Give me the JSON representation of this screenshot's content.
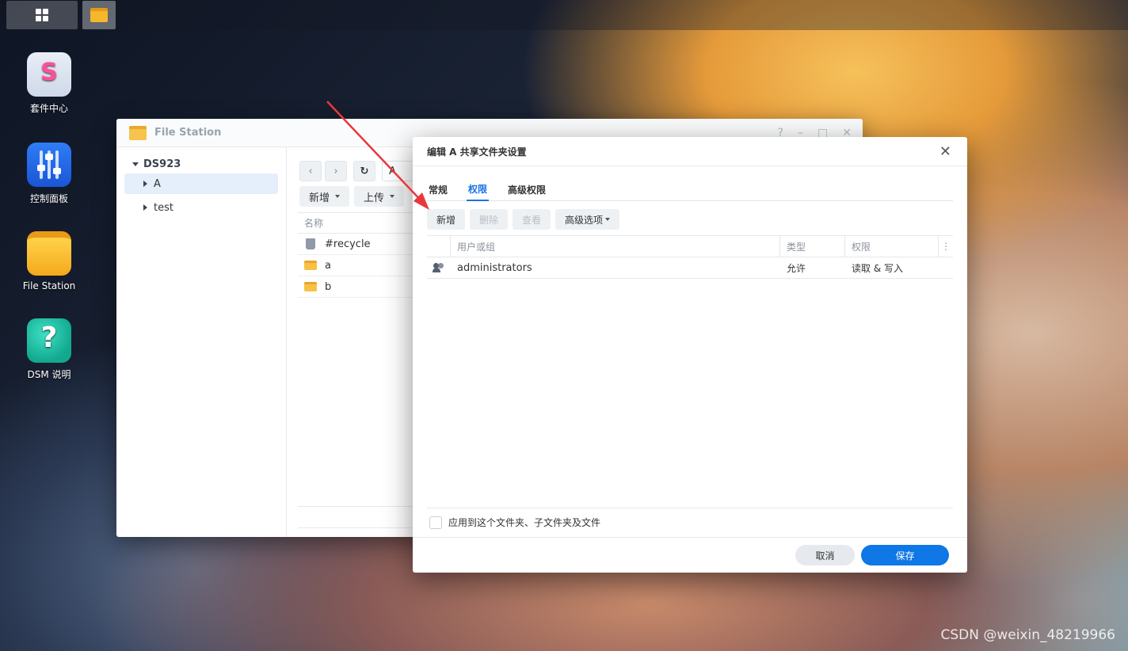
{
  "taskbar": {
    "main_icon": "grid-icon",
    "app_icon": "folder-icon"
  },
  "desktop": {
    "icons": [
      {
        "label": "套件中心",
        "icon": "package-center-icon"
      },
      {
        "label": "控制面板",
        "icon": "control-panel-icon"
      },
      {
        "label": "File Station",
        "icon": "file-station-icon"
      },
      {
        "label": "DSM 说明",
        "icon": "help-icon"
      }
    ]
  },
  "file_station": {
    "title": "File Station",
    "window_controls": {
      "help": "?",
      "minimize": "–",
      "maximize": "□",
      "close": "✕"
    },
    "tree": {
      "root": "DS923",
      "items": [
        "A",
        "test"
      ]
    },
    "nav": {
      "back": "‹",
      "forward": "›",
      "refresh": "↻",
      "path": "A"
    },
    "actions": {
      "create": "新增",
      "upload": "上传"
    },
    "list_header": "名称",
    "files": [
      "#recycle",
      "a",
      "b"
    ]
  },
  "dialog": {
    "title": "编辑 A 共享文件夹设置",
    "close": "✕",
    "tabs": [
      "常规",
      "权限",
      "高级权限"
    ],
    "active_tab": "权限",
    "toolbar": {
      "create": "新增",
      "delete": "删除",
      "view": "查看",
      "advanced": "高级选项"
    },
    "table": {
      "headers": {
        "user_group": "用户或组",
        "type": "类型",
        "permission": "权限",
        "menu": "⋮"
      },
      "rows": [
        {
          "name": "administrators",
          "type": "允许",
          "permission": "读取 & 写入"
        }
      ]
    },
    "apply_checkbox_label": "应用到这个文件夹、子文件夹及文件",
    "buttons": {
      "cancel": "取消",
      "save": "保存"
    }
  },
  "watermark": "CSDN @weixin_48219966",
  "colors": {
    "accent": "#1a73e8",
    "save_button": "#0f77e6",
    "annotation_arrow": "#e8383d"
  }
}
